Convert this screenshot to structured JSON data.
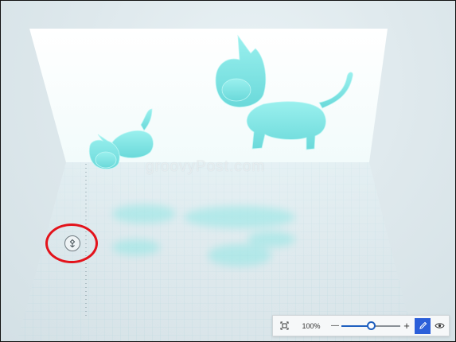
{
  "canvas": {
    "watermark": "groovyPost.com"
  },
  "toolbar": {
    "zoom_value": "100%",
    "zoom_out_label": "—",
    "zoom_in_label": "+",
    "zoom_fraction": 0.5
  },
  "colors": {
    "model": "#7fe3e3",
    "accent": "#2b5fd9",
    "highlight": "#e3131b"
  },
  "icons": {
    "rotate": "rotate-3d-icon",
    "fit": "fit-to-view-icon",
    "pen": "pen-icon",
    "eye": "eye-icon"
  }
}
